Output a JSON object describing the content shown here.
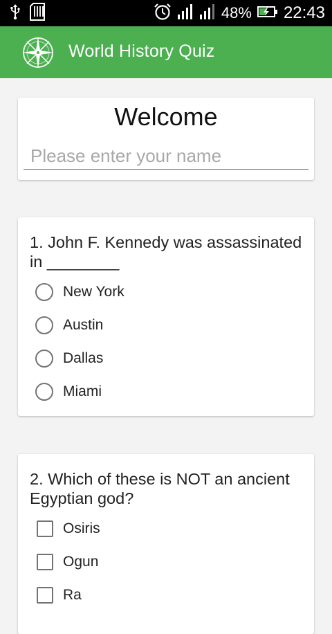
{
  "status_bar": {
    "battery": "48%",
    "time": "22:43",
    "icons": [
      "usb-icon",
      "sd-card-icon",
      "alarm-icon",
      "signal-icon",
      "signal-icon",
      "battery-charging-icon"
    ]
  },
  "app_bar": {
    "title": "World History Quiz",
    "logo_icon": "compass-icon",
    "color": "#4caf50"
  },
  "welcome": {
    "title": "Welcome",
    "name_placeholder": "Please enter your name",
    "name_value": ""
  },
  "questions": [
    {
      "text": "1. John F. Kennedy was assassinated in ________",
      "type": "radio",
      "options": [
        "New York",
        "Austin",
        "Dallas",
        "Miami"
      ]
    },
    {
      "text": "2. Which of these is NOT an ancient Egyptian god?",
      "type": "checkbox",
      "options": [
        "Osiris",
        "Ogun",
        "Ra"
      ]
    }
  ]
}
